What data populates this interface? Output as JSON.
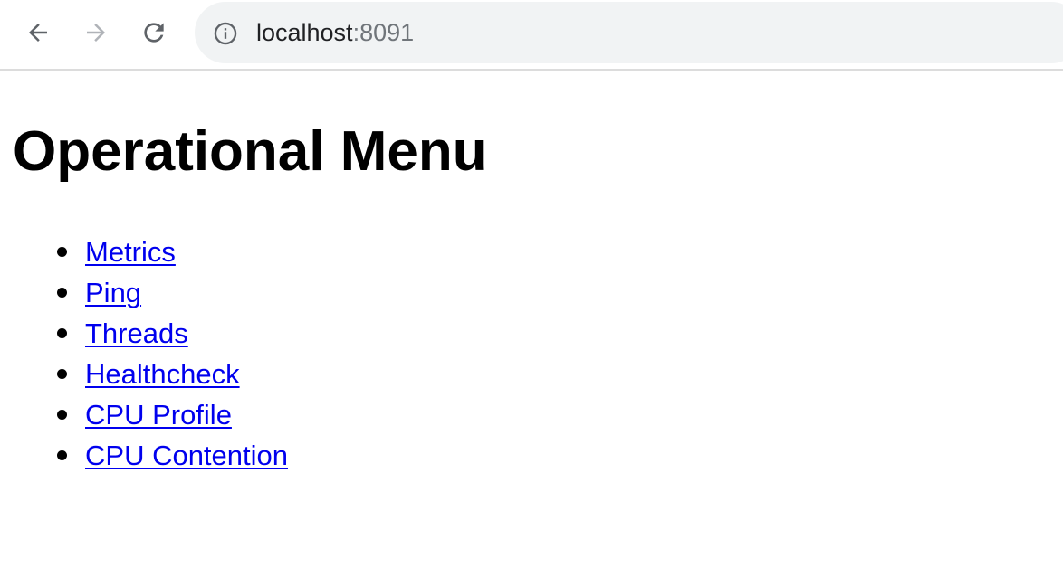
{
  "browser": {
    "url_host": "localhost",
    "url_port": ":8091",
    "colors": {
      "omnibox_bg": "#f1f3f4",
      "icon_active": "#5f6368",
      "icon_disabled": "#b0b3b8"
    }
  },
  "page": {
    "title": "Operational Menu",
    "link_color": "#0000ee",
    "links": [
      {
        "label": "Metrics"
      },
      {
        "label": "Ping"
      },
      {
        "label": "Threads"
      },
      {
        "label": "Healthcheck"
      },
      {
        "label": "CPU Profile"
      },
      {
        "label": "CPU Contention"
      }
    ]
  }
}
